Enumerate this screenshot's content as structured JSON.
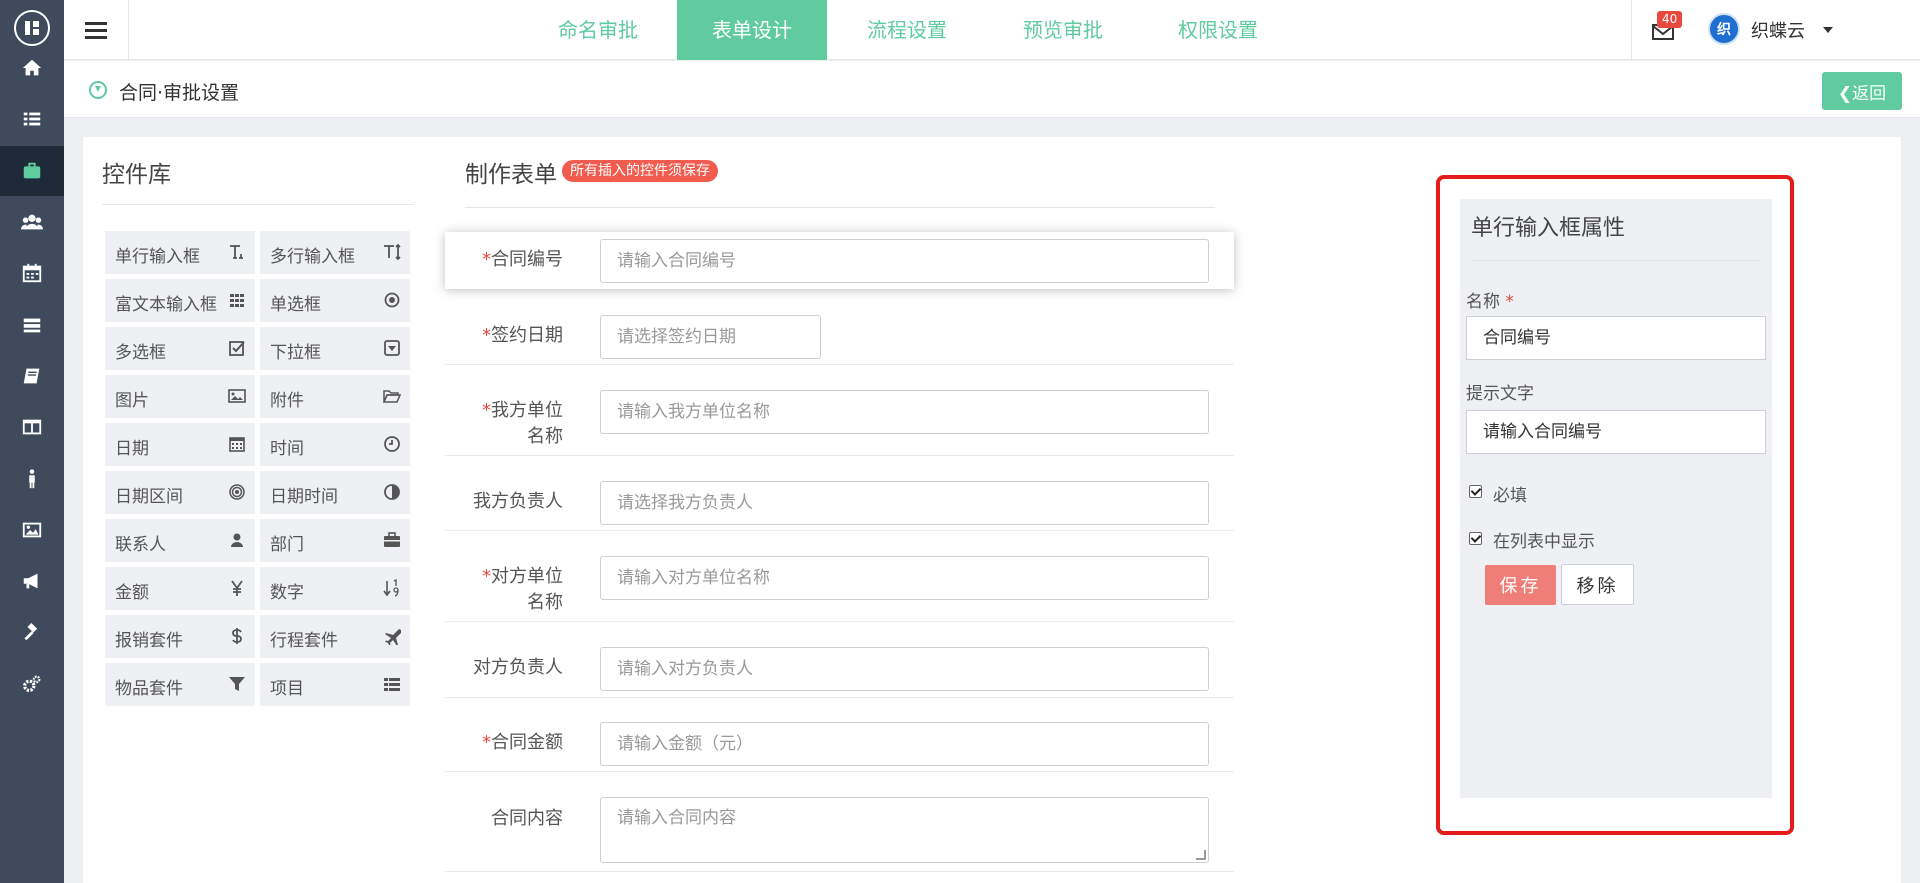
{
  "top_tabs": [
    "命名审批",
    "表单设计",
    "流程设置",
    "预览审批",
    "权限设置"
  ],
  "active_tab": "表单设计",
  "notifications": {
    "count": "40"
  },
  "user": {
    "name": "织蝶云",
    "avatar_text": "织"
  },
  "breadcrumb": {
    "title": "合同·审批设置",
    "back_label": "返回"
  },
  "library": {
    "title": "控件库",
    "controls": [
      {
        "label": "单行输入框",
        "icon": "text-icon"
      },
      {
        "label": "多行输入框",
        "icon": "text-height-icon"
      },
      {
        "label": "富文本输入框",
        "icon": "grid-icon"
      },
      {
        "label": "单选框",
        "icon": "radio-icon"
      },
      {
        "label": "多选框",
        "icon": "checkbox-icon"
      },
      {
        "label": "下拉框",
        "icon": "dropdown-icon"
      },
      {
        "label": "图片",
        "icon": "image-icon"
      },
      {
        "label": "附件",
        "icon": "folder-open-icon"
      },
      {
        "label": "日期",
        "icon": "calendar-icon"
      },
      {
        "label": "时间",
        "icon": "clock-icon"
      },
      {
        "label": "日期区间",
        "icon": "bullseye-icon"
      },
      {
        "label": "日期时间",
        "icon": "half-circle-icon"
      },
      {
        "label": "联系人",
        "icon": "user-icon"
      },
      {
        "label": "部门",
        "icon": "briefcase-icon"
      },
      {
        "label": "金额",
        "icon": "yen-icon"
      },
      {
        "label": "数字",
        "icon": "sort-numeric-icon"
      },
      {
        "label": "报销套件",
        "icon": "dollar-icon"
      },
      {
        "label": "行程套件",
        "icon": "plane-icon"
      },
      {
        "label": "物品套件",
        "icon": "filter-icon"
      },
      {
        "label": "项目",
        "icon": "list-icon"
      }
    ]
  },
  "form": {
    "title": "制作表单",
    "badge": "所有插入的控件须保存",
    "fields": [
      {
        "label_lines": [
          "合同编号"
        ],
        "required": true,
        "placeholder": "请输入合同编号"
      },
      {
        "label_lines": [
          "签约日期"
        ],
        "required": true,
        "placeholder": "请选择签约日期"
      },
      {
        "label_lines": [
          "我方单位",
          "名称"
        ],
        "required": true,
        "placeholder": "请输入我方单位名称"
      },
      {
        "label_lines": [
          "我方负责人"
        ],
        "required": false,
        "placeholder": "请选择我方负责人"
      },
      {
        "label_lines": [
          "对方单位",
          "名称"
        ],
        "required": true,
        "placeholder": "请输入对方单位名称"
      },
      {
        "label_lines": [
          "对方负责人"
        ],
        "required": false,
        "placeholder": "请输入对方负责人"
      },
      {
        "label_lines": [
          "合同金额"
        ],
        "required": true,
        "placeholder": "请输入金额（元）"
      },
      {
        "label_lines": [
          "合同内容"
        ],
        "required": false,
        "placeholder": "请输入合同内容"
      }
    ]
  },
  "properties": {
    "title": "单行输入框属性",
    "name_label": "名称",
    "name_value": "合同编号",
    "hint_label": "提示文字",
    "hint_value": "请输入合同编号",
    "required_label": "必填",
    "required_checked": true,
    "show_in_list_label": "在列表中显示",
    "show_in_list_checked": true,
    "save_label": "保存",
    "remove_label": "移除"
  },
  "colors": {
    "accent": "#5fcb9f",
    "sidebar": "#3f4a5c",
    "danger": "#e8493e",
    "highlight_frame": "#e61c1c"
  }
}
